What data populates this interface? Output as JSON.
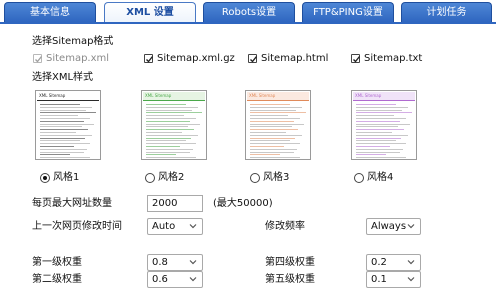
{
  "tabs": [
    {
      "label": "基本信息",
      "active": false
    },
    {
      "label": "XML 设置",
      "active": true
    },
    {
      "label": "Robots设置",
      "active": false
    },
    {
      "label": "FTP&PING设置",
      "active": false
    },
    {
      "label": "计划任务",
      "active": false
    }
  ],
  "format_section": {
    "title": "选择Sitemap格式",
    "options": [
      {
        "label": "Sitemap.xml",
        "checked": true,
        "disabled": true
      },
      {
        "label": "Sitemap.xml.gz",
        "checked": true,
        "disabled": false
      },
      {
        "label": "Sitemap.html",
        "checked": true,
        "disabled": false
      },
      {
        "label": "Sitemap.txt",
        "checked": true,
        "disabled": false
      }
    ]
  },
  "style_section": {
    "title": "选择XML样式",
    "thumb_header": "XML Sitemap",
    "styles": [
      {
        "label": "风格1",
        "selected": true,
        "accent": "#2a2a2a",
        "band": "#ffffff"
      },
      {
        "label": "风格2",
        "selected": false,
        "accent": "#4aa84a",
        "band": "#e6f4e3"
      },
      {
        "label": "风格3",
        "selected": false,
        "accent": "#e08a5a",
        "band": "#fbe9e0"
      },
      {
        "label": "风格4",
        "selected": false,
        "accent": "#b06ad0",
        "band": "#f0e3f8"
      }
    ]
  },
  "max_urls": {
    "label": "每页最大网址数量",
    "value": "2000",
    "hint": "(最大50000)"
  },
  "last_mod": {
    "label": "上一次网页修改时间",
    "value": "Auto"
  },
  "change_freq": {
    "label": "修改频率",
    "value": "Always"
  },
  "priorities": [
    {
      "label": "第一级权重",
      "value": "0.8"
    },
    {
      "label": "第二级权重",
      "value": "0.6"
    },
    {
      "label": "第四级权重",
      "value": "0.2"
    },
    {
      "label": "第五级权重",
      "value": "0.1"
    }
  ],
  "colors": {
    "tab": "#2f66c0",
    "tab_active_text": "#1d4ea1"
  }
}
